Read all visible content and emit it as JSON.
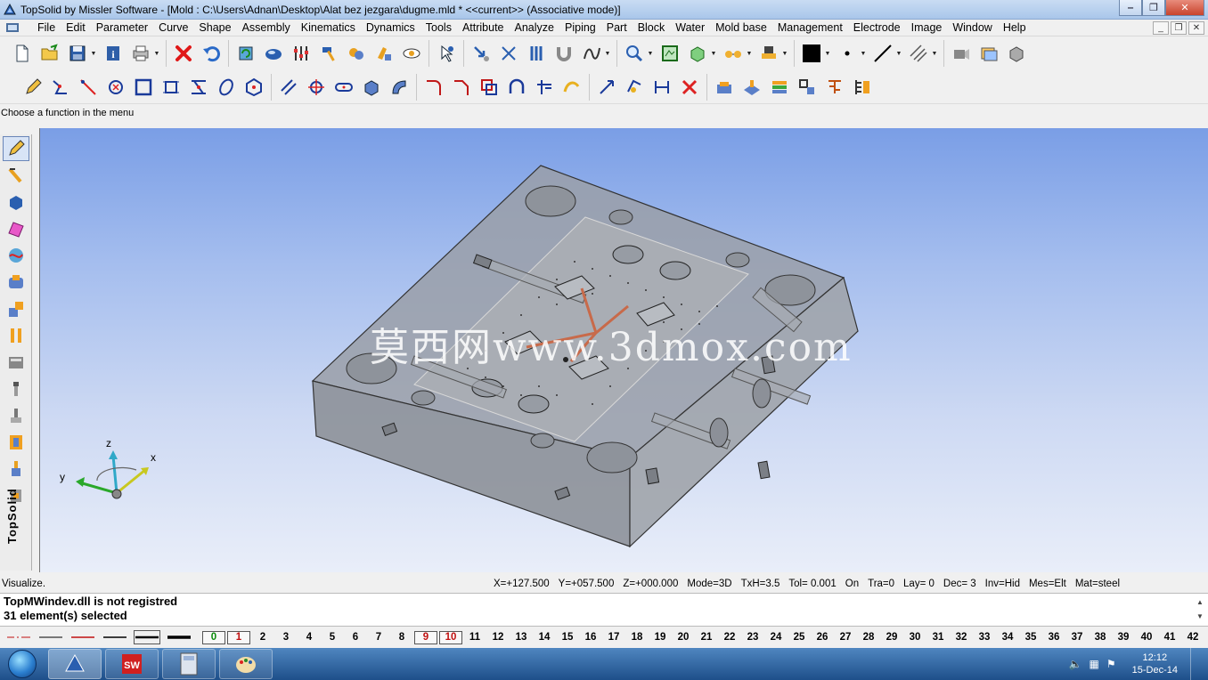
{
  "window": {
    "title": "TopSolid by Missler Software - [Mold : C:\\Users\\Adnan\\Desktop\\Alat bez jezgara\\dugme.mld *  <<current>> (Associative mode)]",
    "controls": [
      "minimize",
      "restore",
      "close"
    ]
  },
  "menu": {
    "items": [
      "File",
      "Edit",
      "Parameter",
      "Curve",
      "Shape",
      "Assembly",
      "Kinematics",
      "Dynamics",
      "Tools",
      "Attribute",
      "Analyze",
      "Piping",
      "Part",
      "Block",
      "Water",
      "Mold base",
      "Management",
      "Electrode",
      "Image",
      "Window",
      "Help"
    ]
  },
  "hint": "Choose a function in the menu",
  "left_toolbar": {
    "brand": "TopSolid"
  },
  "viewport": {
    "watermark": "莫西网www.3dmox.com",
    "axes": {
      "x": "x",
      "y": "y",
      "z": "z"
    }
  },
  "status": {
    "left": "Visualize.",
    "fields": [
      "X=+127.500",
      "Y=+057.500",
      "Z=+000.000",
      "Mode=3D",
      "TxH=3.5",
      "Tol= 0.001",
      "On",
      "Tra=0",
      "Lay=  0",
      "Dec= 3",
      "Inv=Hid",
      "Mes=Elt",
      "Mat=steel"
    ]
  },
  "messages": [
    "TopMWindev.dll is not registred",
    "31 element(s) selected"
  ],
  "layers": [
    "0",
    "1",
    "2",
    "3",
    "4",
    "5",
    "6",
    "7",
    "8",
    "9",
    "10",
    "11",
    "12",
    "13",
    "14",
    "15",
    "16",
    "17",
    "18",
    "19",
    "20",
    "21",
    "22",
    "23",
    "24",
    "25",
    "26",
    "27",
    "28",
    "29",
    "30",
    "31",
    "32",
    "33",
    "34",
    "35",
    "36",
    "37",
    "38",
    "39",
    "40",
    "41",
    "42"
  ],
  "taskbar": {
    "time": "12:12",
    "date": "15-Dec-14"
  },
  "colors": {
    "accent": "#1e4f8a",
    "viewport_top": "#7a9ee6",
    "viewport_bottom": "#e9eef9",
    "layer_active": "#0a8a0a",
    "layer_red": "#c01010"
  }
}
